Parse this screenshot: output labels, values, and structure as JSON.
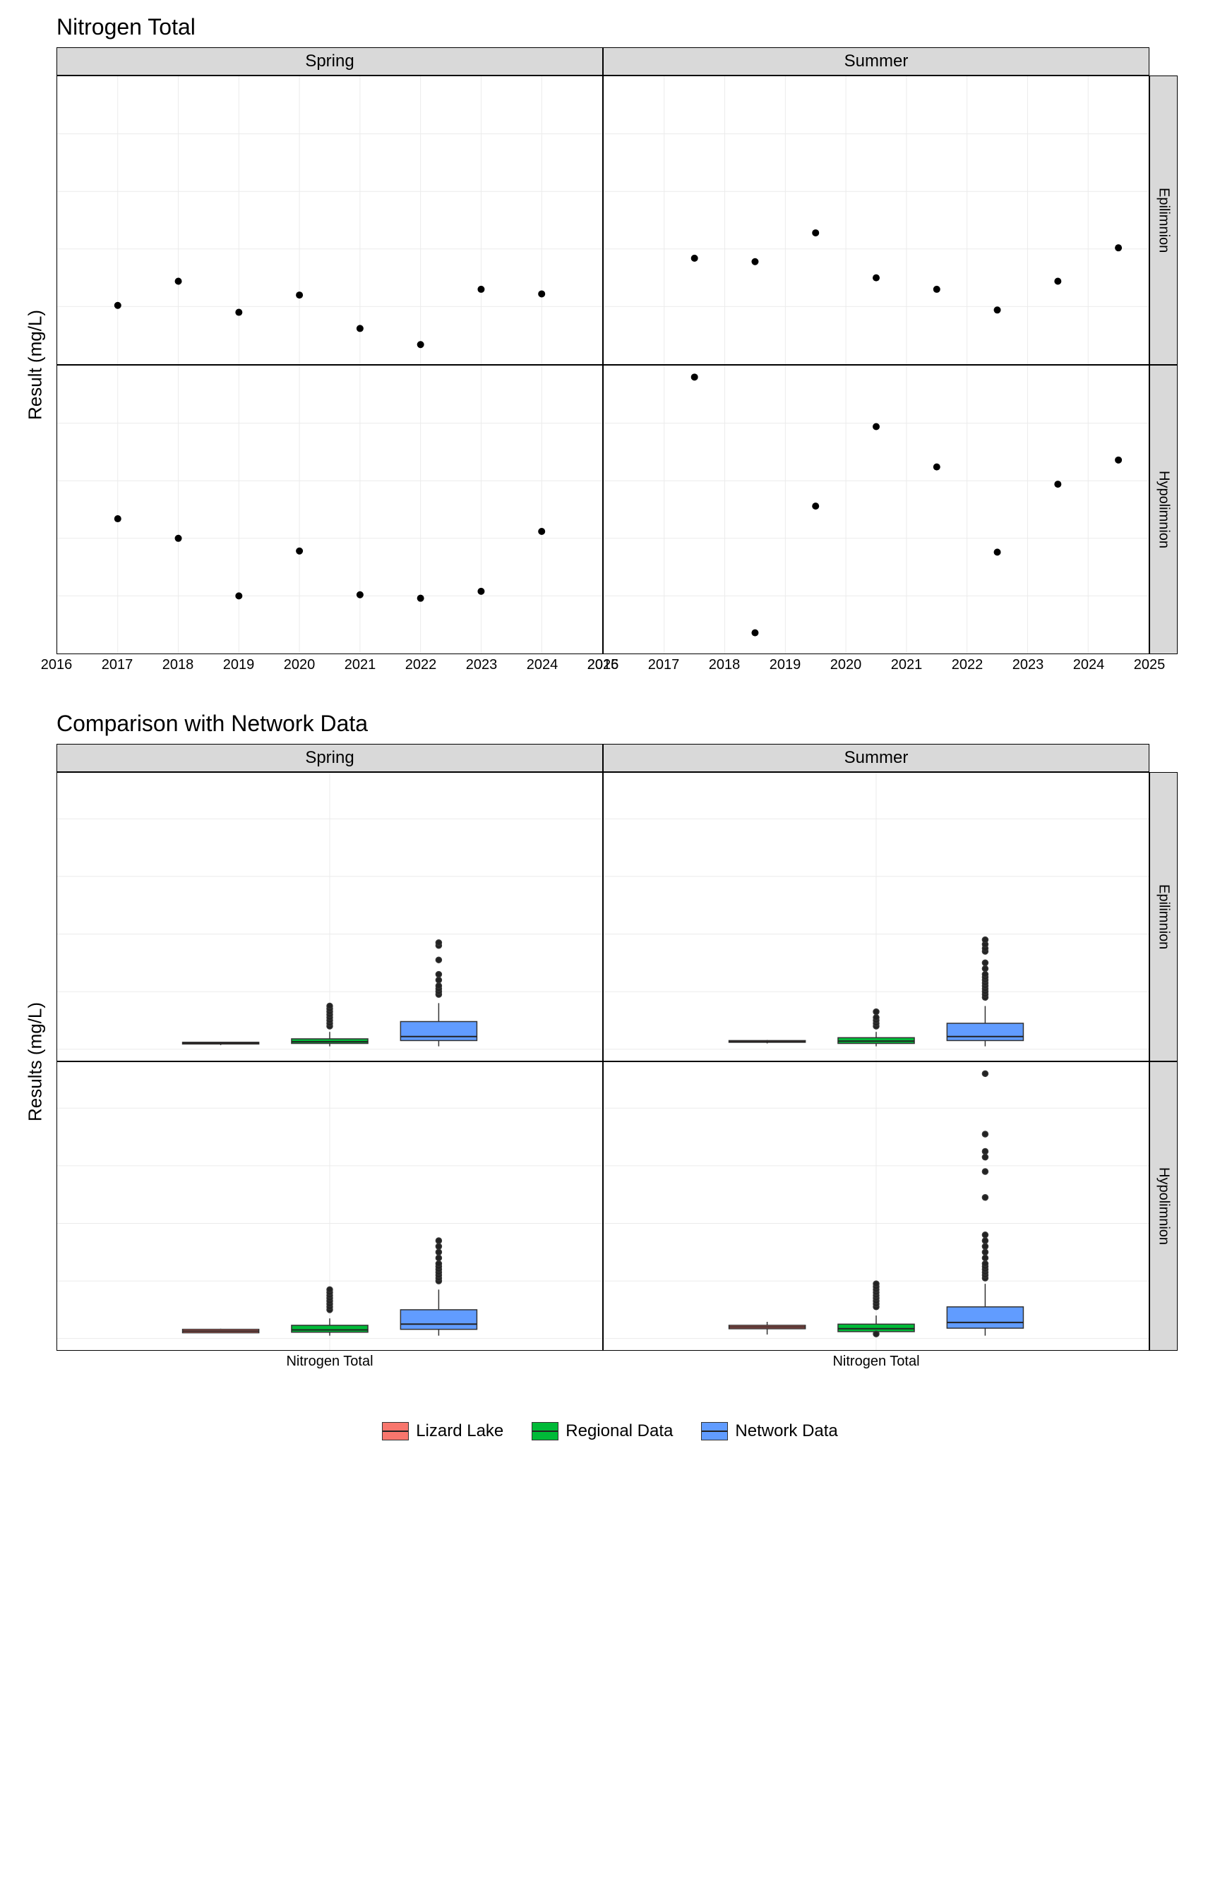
{
  "chart_data": [
    {
      "type": "scatter",
      "title": "Nitrogen Total",
      "ylabel": "Result (mg/L)",
      "xlim": [
        2016,
        2025
      ],
      "ylim": [
        0.05,
        0.3
      ],
      "yticks": [
        0.1,
        0.15,
        0.2,
        0.25
      ],
      "xticks": [
        2016,
        2017,
        2018,
        2019,
        2020,
        2021,
        2022,
        2023,
        2024,
        2025
      ],
      "col_facets": [
        "Spring",
        "Summer"
      ],
      "row_facets": [
        "Epilimnion",
        "Hypolimnion"
      ],
      "panels": {
        "Spring_Epilimnion": [
          {
            "x": 2017,
            "y": 0.101
          },
          {
            "x": 2018,
            "y": 0.122
          },
          {
            "x": 2019,
            "y": 0.095
          },
          {
            "x": 2020,
            "y": 0.11
          },
          {
            "x": 2021,
            "y": 0.081
          },
          {
            "x": 2022,
            "y": 0.067
          },
          {
            "x": 2023,
            "y": 0.115
          },
          {
            "x": 2024,
            "y": 0.111
          }
        ],
        "Summer_Epilimnion": [
          {
            "x": 2017.5,
            "y": 0.142
          },
          {
            "x": 2018.5,
            "y": 0.139
          },
          {
            "x": 2019.5,
            "y": 0.164
          },
          {
            "x": 2020.5,
            "y": 0.125
          },
          {
            "x": 2021.5,
            "y": 0.115
          },
          {
            "x": 2022.5,
            "y": 0.097
          },
          {
            "x": 2023.5,
            "y": 0.122
          },
          {
            "x": 2024.5,
            "y": 0.151
          }
        ],
        "Spring_Hypolimnion": [
          {
            "x": 2017,
            "y": 0.167
          },
          {
            "x": 2018,
            "y": 0.15
          },
          {
            "x": 2019,
            "y": 0.1
          },
          {
            "x": 2020,
            "y": 0.139
          },
          {
            "x": 2021,
            "y": 0.101
          },
          {
            "x": 2022,
            "y": 0.098
          },
          {
            "x": 2023,
            "y": 0.104
          },
          {
            "x": 2024,
            "y": 0.156
          }
        ],
        "Summer_Hypolimnion": [
          {
            "x": 2017.5,
            "y": 0.29
          },
          {
            "x": 2018.5,
            "y": 0.068
          },
          {
            "x": 2019.5,
            "y": 0.178
          },
          {
            "x": 2020.5,
            "y": 0.247
          },
          {
            "x": 2021.5,
            "y": 0.212
          },
          {
            "x": 2022.5,
            "y": 0.138
          },
          {
            "x": 2023.5,
            "y": 0.197
          },
          {
            "x": 2024.5,
            "y": 0.218
          }
        ]
      }
    },
    {
      "type": "box",
      "title": "Comparison with Network Data",
      "ylabel": "Results (mg/L)",
      "xlabel_category": "Nitrogen Total",
      "ylim": [
        -0.2,
        4.8
      ],
      "yticks": [
        0,
        1,
        2,
        3,
        4
      ],
      "col_facets": [
        "Spring",
        "Summer"
      ],
      "row_facets": [
        "Epilimnion",
        "Hypolimnion"
      ],
      "series": [
        "Lizard Lake",
        "Regional Data",
        "Network Data"
      ],
      "colors": {
        "Lizard Lake": "#f8766d",
        "Regional Data": "#00ba38",
        "Network Data": "#619cff"
      },
      "panels": {
        "Spring_Epilimnion": {
          "Lizard Lake": {
            "min": 0.07,
            "q1": 0.09,
            "med": 0.11,
            "q3": 0.12,
            "max": 0.12,
            "out": []
          },
          "Regional Data": {
            "min": 0.05,
            "q1": 0.1,
            "med": 0.13,
            "q3": 0.18,
            "max": 0.3,
            "out": [
              0.4,
              0.45,
              0.5,
              0.55,
              0.6,
              0.65,
              0.7,
              0.75
            ]
          },
          "Network Data": {
            "min": 0.05,
            "q1": 0.15,
            "med": 0.22,
            "q3": 0.48,
            "max": 0.8,
            "out": [
              0.95,
              1.0,
              1.05,
              1.1,
              1.2,
              1.3,
              1.55,
              1.8,
              1.85
            ]
          }
        },
        "Summer_Epilimnion": {
          "Lizard Lake": {
            "min": 0.1,
            "q1": 0.12,
            "med": 0.13,
            "q3": 0.15,
            "max": 0.16,
            "out": []
          },
          "Regional Data": {
            "min": 0.05,
            "q1": 0.1,
            "med": 0.14,
            "q3": 0.2,
            "max": 0.3,
            "out": [
              0.4,
              0.45,
              0.5,
              0.55,
              0.65
            ]
          },
          "Network Data": {
            "min": 0.05,
            "q1": 0.15,
            "med": 0.22,
            "q3": 0.45,
            "max": 0.75,
            "out": [
              0.9,
              0.95,
              1.0,
              1.05,
              1.1,
              1.15,
              1.2,
              1.25,
              1.3,
              1.4,
              1.5,
              1.7,
              1.75,
              1.82,
              1.9
            ]
          }
        },
        "Spring_Hypolimnion": {
          "Lizard Lake": {
            "min": 0.1,
            "q1": 0.1,
            "med": 0.13,
            "q3": 0.16,
            "max": 0.17,
            "out": []
          },
          "Regional Data": {
            "min": 0.05,
            "q1": 0.11,
            "med": 0.15,
            "q3": 0.23,
            "max": 0.35,
            "out": [
              0.5,
              0.55,
              0.6,
              0.65,
              0.7,
              0.75,
              0.8,
              0.85
            ]
          },
          "Network Data": {
            "min": 0.05,
            "q1": 0.16,
            "med": 0.25,
            "q3": 0.5,
            "max": 0.85,
            "out": [
              1.0,
              1.05,
              1.1,
              1.15,
              1.2,
              1.25,
              1.3,
              1.4,
              1.5,
              1.6,
              1.7
            ]
          }
        },
        "Summer_Hypolimnion": {
          "Lizard Lake": {
            "min": 0.07,
            "q1": 0.17,
            "med": 0.2,
            "q3": 0.23,
            "max": 0.29,
            "out": []
          },
          "Regional Data": {
            "min": 0.05,
            "q1": 0.12,
            "med": 0.17,
            "q3": 0.25,
            "max": 0.4,
            "out": [
              0.08,
              0.55,
              0.6,
              0.65,
              0.7,
              0.75,
              0.8,
              0.85,
              0.9,
              0.95
            ]
          },
          "Network Data": {
            "min": 0.05,
            "q1": 0.18,
            "med": 0.28,
            "q3": 0.55,
            "max": 0.95,
            "out": [
              1.05,
              1.1,
              1.15,
              1.2,
              1.25,
              1.3,
              1.4,
              1.5,
              1.6,
              1.7,
              1.8,
              2.45,
              2.9,
              3.15,
              3.25,
              3.55,
              4.6
            ]
          }
        }
      }
    }
  ],
  "legend": {
    "items": [
      {
        "label": "Lizard Lake",
        "color": "#f8766d"
      },
      {
        "label": "Regional Data",
        "color": "#00ba38"
      },
      {
        "label": "Network Data",
        "color": "#619cff"
      }
    ]
  }
}
